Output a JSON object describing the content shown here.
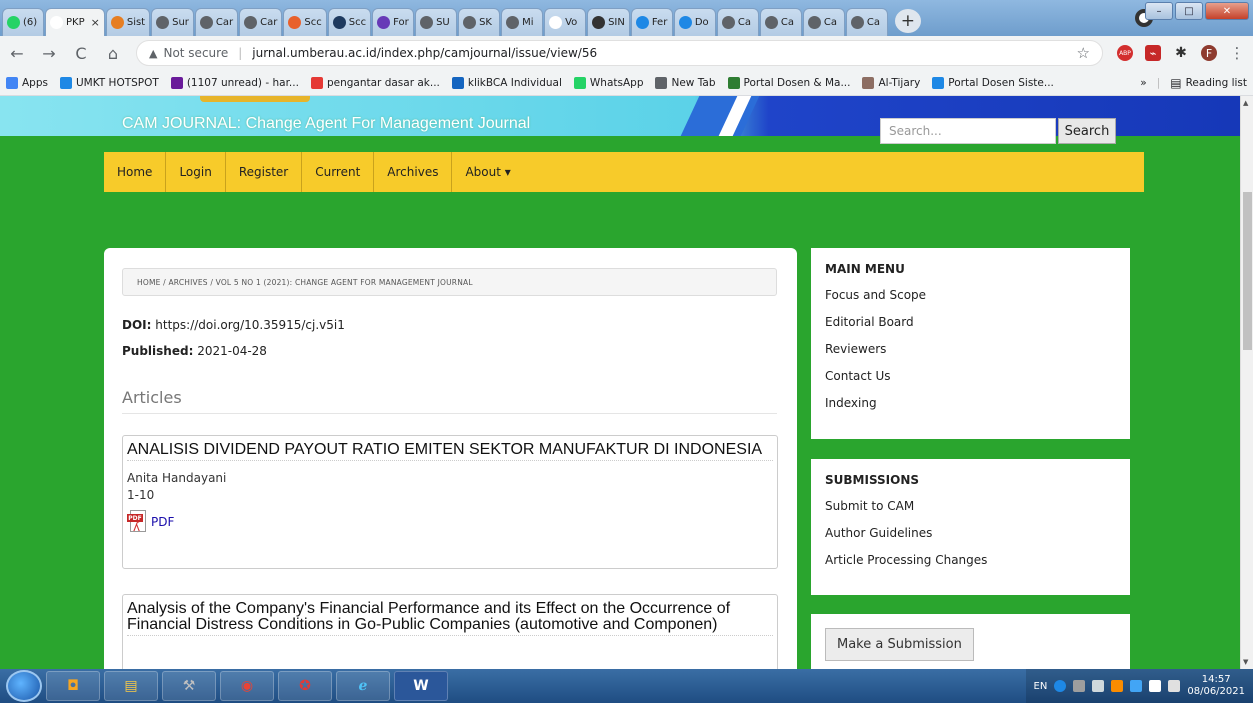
{
  "browser": {
    "tabs": [
      {
        "label": "(6)",
        "icon": "whatsapp-icon",
        "color": "#25d366"
      },
      {
        "label": "PKP",
        "icon": "pkp-icon",
        "color": "#ffffff",
        "active": true
      },
      {
        "label": "Sist",
        "icon": "user-icon",
        "color": "#e67e22"
      },
      {
        "label": "Sur",
        "icon": "globe-icon",
        "color": "#5f6368"
      },
      {
        "label": "Car",
        "icon": "globe-icon",
        "color": "#5f6368"
      },
      {
        "label": "Car",
        "icon": "globe-icon",
        "color": "#5f6368"
      },
      {
        "label": "Scc",
        "icon": "scopus-icon",
        "color": "#e8612c"
      },
      {
        "label": "Scc",
        "icon": "dot-icon",
        "color": "#1e3a5f"
      },
      {
        "label": "For",
        "icon": "forms-icon",
        "color": "#673ab7"
      },
      {
        "label": "SU",
        "icon": "globe-icon",
        "color": "#5f6368"
      },
      {
        "label": "SK",
        "icon": "globe-icon",
        "color": "#5f6368"
      },
      {
        "label": "Mi",
        "icon": "globe-icon",
        "color": "#5f6368"
      },
      {
        "label": "Vo",
        "icon": "pkp-icon",
        "color": "#ffffff"
      },
      {
        "label": "SIN",
        "icon": "sinta-icon",
        "color": "#333333"
      },
      {
        "label": "Fer",
        "icon": "diamond-icon",
        "color": "#1e88e5"
      },
      {
        "label": "Do",
        "icon": "download-icon",
        "color": "#1e88e5"
      },
      {
        "label": "Ca",
        "icon": "globe-icon",
        "color": "#5f6368"
      },
      {
        "label": "Ca",
        "icon": "globe-icon",
        "color": "#5f6368"
      },
      {
        "label": "Ca",
        "icon": "globe-icon",
        "color": "#5f6368"
      },
      {
        "label": "Ca",
        "icon": "globe-icon",
        "color": "#5f6368"
      }
    ],
    "close_glyph": "×",
    "new_tab": "+",
    "window_controls": {
      "minimize": "–",
      "maximize": "□",
      "close": "✕"
    },
    "nav": {
      "back": "←",
      "forward": "→",
      "reload": "C",
      "home": "⌂"
    },
    "security": "Not secure",
    "url": "jurnal.umberau.ac.id/index.php/camjournal/issue/view/56",
    "toolbar_icons": {
      "star": "☆",
      "abp_badge": "ABP",
      "profile_initial": "F",
      "menu": "⋮"
    },
    "bookmarks": [
      {
        "label": "Apps",
        "color": "#4285f4"
      },
      {
        "label": "UMKT HOTSPOT",
        "color": "#1e88e5"
      },
      {
        "label": "(1107 unread) - har...",
        "color": "#6a1b9a"
      },
      {
        "label": "pengantar dasar ak...",
        "color": "#e53935"
      },
      {
        "label": "klikBCA Individual",
        "color": "#1565c0"
      },
      {
        "label": "WhatsApp",
        "color": "#25d366"
      },
      {
        "label": "New Tab",
        "color": "#5f6368"
      },
      {
        "label": "Portal Dosen & Ma...",
        "color": "#2e7d32"
      },
      {
        "label": "Al-Tijary",
        "color": "#8d6e63"
      },
      {
        "label": "Portal Dosen Siste...",
        "color": "#1e88e5"
      }
    ],
    "bookmarks_more": "»",
    "reading_list": "Reading list"
  },
  "site": {
    "title": "CAM JOURNAL: Change Agent For Management Journal",
    "search_placeholder": "Search...",
    "search_button": "Search",
    "nav": [
      "Home",
      "Login",
      "Register",
      "Current",
      "Archives",
      "About ▾"
    ]
  },
  "issue": {
    "breadcrumb": "HOME  /  ARCHIVES  /  VOL 5 NO 1 (2021): CHANGE AGENT FOR MANAGEMENT JOURNAL",
    "doi_label": "DOI:",
    "doi_value": "https://doi.org/10.35915/cj.v5i1",
    "published_label": "Published:",
    "published_value": "2021-04-28",
    "section_heading": "Articles",
    "articles": [
      {
        "title": "ANALISIS DIVIDEND PAYOUT RATIO EMITEN SEKTOR MANUFAKTUR DI INDONESIA",
        "author": "Anita Handayani",
        "pages": "1-10",
        "galley": "PDF"
      },
      {
        "title": "Analysis of the Company's Financial Performance and its Effect on the Occurrence of Financial Distress Conditions in Go-Public Companies (automotive and Componen)"
      }
    ]
  },
  "sidebar": {
    "main_menu": {
      "heading": "MAIN MENU",
      "links": [
        "Focus and Scope",
        "Editorial Board",
        "Reviewers",
        "Contact Us",
        "Indexing"
      ]
    },
    "submissions": {
      "heading": "SUBMISSIONS",
      "links": [
        "Submit to CAM",
        "Author Guidelines",
        "Article Processing Changes"
      ]
    },
    "make_submission": "Make a Submission"
  },
  "taskbar": {
    "word_label": "W",
    "language": "EN",
    "time": "14:57",
    "date": "08/06/2021"
  }
}
